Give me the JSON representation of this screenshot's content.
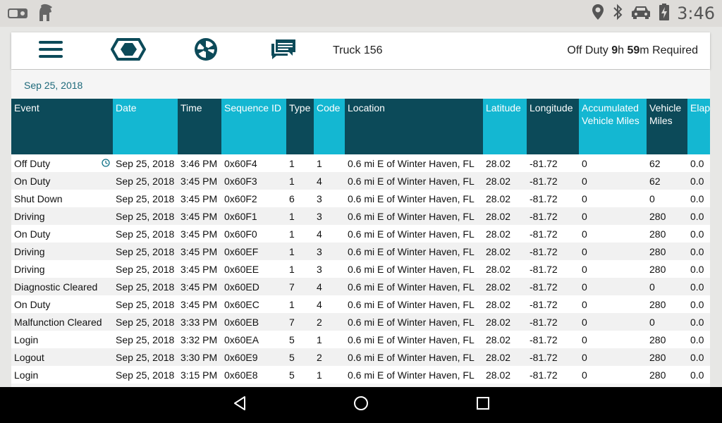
{
  "status_bar": {
    "time": "3:46",
    "icons": [
      "camera-toggle-icon",
      "spartan-helmet-icon",
      "location-pin-icon",
      "bluetooth-icon",
      "car-icon",
      "battery-charging-icon"
    ]
  },
  "toolbar": {
    "icons": [
      "menu-icon",
      "hexagon-logo-icon",
      "radiation-icon",
      "chat-icon"
    ],
    "truck_label": "Truck 156",
    "duty_prefix": "Off Duty ",
    "duty_hours": "9",
    "duty_hours_unit": "h ",
    "duty_minutes": "59",
    "duty_minutes_unit": "m Required"
  },
  "content": {
    "date_header": "Sep 25, 2018",
    "columns": [
      "Event",
      "Date",
      "Time",
      "Sequence ID",
      "Type",
      "Code",
      "Location",
      "Latitude",
      "Longitude",
      "Accumulated Vehicle Miles",
      "Vehicle Miles",
      "Elapsed Engine"
    ],
    "rows": [
      [
        "Off Duty",
        "Sep 25, 2018",
        "3:46 PM",
        "0x60F4",
        "1",
        "1",
        "0.6 mi E of Winter Haven, FL",
        "28.02",
        "-81.72",
        "0",
        "62",
        "0.0"
      ],
      [
        "On Duty",
        "Sep 25, 2018",
        "3:45 PM",
        "0x60F3",
        "1",
        "4",
        "0.6 mi E of Winter Haven, FL",
        "28.02",
        "-81.72",
        "0",
        "62",
        "0.0"
      ],
      [
        "Shut Down",
        "Sep 25, 2018",
        "3:45 PM",
        "0x60F2",
        "6",
        "3",
        "0.6 mi E of Winter Haven, FL",
        "28.02",
        "-81.72",
        "0",
        "0",
        "0.0"
      ],
      [
        "Driving",
        "Sep 25, 2018",
        "3:45 PM",
        "0x60F1",
        "1",
        "3",
        "0.6 mi E of Winter Haven, FL",
        "28.02",
        "-81.72",
        "0",
        "280",
        "0.0"
      ],
      [
        "On Duty",
        "Sep 25, 2018",
        "3:45 PM",
        "0x60F0",
        "1",
        "4",
        "0.6 mi E of Winter Haven, FL",
        "28.02",
        "-81.72",
        "0",
        "280",
        "0.0"
      ],
      [
        "Driving",
        "Sep 25, 2018",
        "3:45 PM",
        "0x60EF",
        "1",
        "3",
        "0.6 mi E of Winter Haven, FL",
        "28.02",
        "-81.72",
        "0",
        "280",
        "0.0"
      ],
      [
        "Driving",
        "Sep 25, 2018",
        "3:45 PM",
        "0x60EE",
        "1",
        "3",
        "0.6 mi E of Winter Haven, FL",
        "28.02",
        "-81.72",
        "0",
        "280",
        "0.0"
      ],
      [
        "Diagnostic Cleared",
        "Sep 25, 2018",
        "3:45 PM",
        "0x60ED",
        "7",
        "4",
        "0.6 mi E of Winter Haven, FL",
        "28.02",
        "-81.72",
        "0",
        "0",
        "0.0"
      ],
      [
        "On Duty",
        "Sep 25, 2018",
        "3:45 PM",
        "0x60EC",
        "1",
        "4",
        "0.6 mi E of Winter Haven, FL",
        "28.02",
        "-81.72",
        "0",
        "280",
        "0.0"
      ],
      [
        "Malfunction Cleared",
        "Sep 25, 2018",
        "3:33 PM",
        "0x60EB",
        "7",
        "2",
        "0.6 mi E of Winter Haven, FL",
        "28.02",
        "-81.72",
        "0",
        "0",
        "0.0"
      ],
      [
        "Login",
        "Sep 25, 2018",
        "3:32 PM",
        "0x60EA",
        "5",
        "1",
        "0.6 mi E of Winter Haven, FL",
        "28.02",
        "-81.72",
        "0",
        "280",
        "0.0"
      ],
      [
        "Logout",
        "Sep 25, 2018",
        "3:30 PM",
        "0x60E9",
        "5",
        "2",
        "0.6 mi E of Winter Haven, FL",
        "28.02",
        "-81.72",
        "0",
        "280",
        "0.0"
      ],
      [
        "Login",
        "Sep 25, 2018",
        "3:15 PM",
        "0x60E8",
        "5",
        "1",
        "0.6 mi E of Winter Haven, FL",
        "28.02",
        "-81.72",
        "0",
        "280",
        "0.0"
      ]
    ]
  },
  "nav_bar": {
    "icons": [
      "back-icon",
      "home-icon",
      "recents-icon"
    ]
  },
  "colors": {
    "header_dark": "#0c4a59",
    "header_light": "#14b7d2",
    "date_header": "#1e6a7b"
  }
}
